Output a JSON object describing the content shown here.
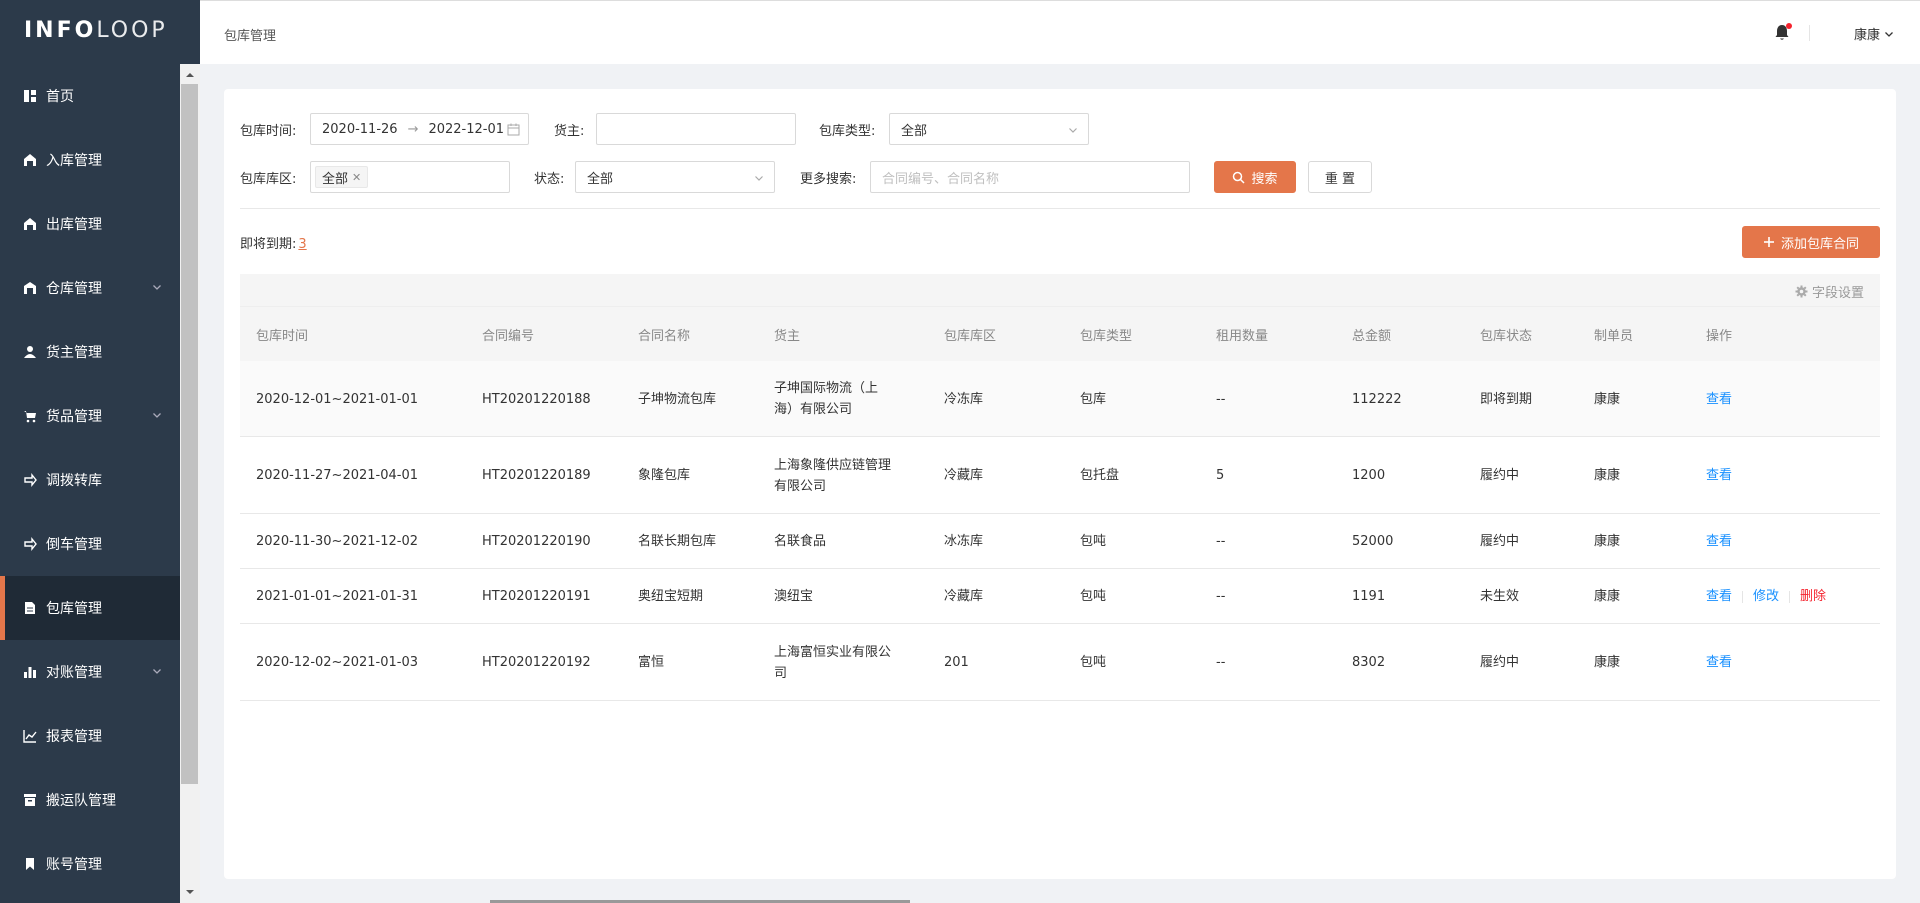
{
  "brand": {
    "bold": "INFO",
    "light": "LOOP"
  },
  "sidebar": {
    "items": [
      {
        "label": "首页",
        "icon": "dashboard-icon",
        "expandable": false,
        "active": false
      },
      {
        "label": "入库管理",
        "icon": "warehouse-in-icon",
        "expandable": false,
        "active": false
      },
      {
        "label": "出库管理",
        "icon": "warehouse-out-icon",
        "expandable": false,
        "active": false
      },
      {
        "label": "仓库管理",
        "icon": "warehouse-icon",
        "expandable": true,
        "active": false
      },
      {
        "label": "货主管理",
        "icon": "user-icon",
        "expandable": false,
        "active": false
      },
      {
        "label": "货品管理",
        "icon": "cart-icon",
        "expandable": true,
        "active": false
      },
      {
        "label": "调拨转库",
        "icon": "transfer-icon",
        "expandable": false,
        "active": false
      },
      {
        "label": "倒车管理",
        "icon": "truck-icon",
        "expandable": false,
        "active": false
      },
      {
        "label": "包库管理",
        "icon": "document-icon",
        "expandable": false,
        "active": true
      },
      {
        "label": "对账管理",
        "icon": "bar-chart-icon",
        "expandable": true,
        "active": false
      },
      {
        "label": "报表管理",
        "icon": "line-chart-icon",
        "expandable": false,
        "active": false
      },
      {
        "label": "搬运队管理",
        "icon": "archive-icon",
        "expandable": false,
        "active": false
      },
      {
        "label": "账号管理",
        "icon": "bookmark-icon",
        "expandable": false,
        "active": false
      }
    ]
  },
  "header": {
    "breadcrumb": "包库管理",
    "user": "康康"
  },
  "filters": {
    "date_label": "包库时间:",
    "date_start": "2020-11-26",
    "date_end": "2022-12-01",
    "owner_label": "货主:",
    "owner_value": "",
    "type_label": "包库类型:",
    "type_value": "全部",
    "zone_label": "包库库区:",
    "zone_tag": "全部",
    "status_label": "状态:",
    "status_value": "全部",
    "more_label": "更多搜索:",
    "more_placeholder": "合同编号、合同名称",
    "search_btn": "搜索",
    "reset_btn": "重 置"
  },
  "expiring": {
    "label": "即将到期:",
    "count": "3"
  },
  "add_btn": "添加包库合同",
  "field_settings": "字段设置",
  "table": {
    "columns": [
      "包库时间",
      "合同编号",
      "合同名称",
      "货主",
      "包库库区",
      "包库类型",
      "租用数量",
      "总金额",
      "包库状态",
      "制单员",
      "操作"
    ],
    "rows": [
      {
        "time": "2020-12-01~2021-01-01",
        "code": "HT20201220188",
        "name": "子坤物流包库",
        "owner1": "子坤国际物流（上",
        "owner2": "海）有限公司",
        "zone": "冷冻库",
        "type": "包库",
        "qty": "--",
        "amount": "112222",
        "status": "即将到期",
        "creator": "康康",
        "view": "查看",
        "edit": "",
        "del": ""
      },
      {
        "time": "2020-11-27~2021-04-01",
        "code": "HT20201220189",
        "name": "象隆包库",
        "owner1": "上海象隆供应链管理",
        "owner2": "有限公司",
        "zone": "冷藏库",
        "type": "包托盘",
        "qty": "5",
        "amount": "1200",
        "status": "履约中",
        "creator": "康康",
        "view": "查看",
        "edit": "",
        "del": ""
      },
      {
        "time": "2020-11-30~2021-12-02",
        "code": "HT20201220190",
        "name": "名联长期包库",
        "owner1": "名联食品",
        "owner2": "",
        "zone": "冰冻库",
        "type": "包吨",
        "qty": "--",
        "amount": "52000",
        "status": "履约中",
        "creator": "康康",
        "view": "查看",
        "edit": "",
        "del": ""
      },
      {
        "time": "2021-01-01~2021-01-31",
        "code": "HT20201220191",
        "name": "奥纽宝短期",
        "owner1": "澳纽宝",
        "owner2": "",
        "zone": "冷藏库",
        "type": "包吨",
        "qty": "--",
        "amount": "1191",
        "status": "未生效",
        "creator": "康康",
        "view": "查看",
        "edit": "修改",
        "del": "删除"
      },
      {
        "time": "2020-12-02~2021-01-03",
        "code": "HT20201220192",
        "name": "富恒",
        "owner1": "上海富恒实业有限公",
        "owner2": "司",
        "zone": "201",
        "type": "包吨",
        "qty": "--",
        "amount": "8302",
        "status": "履约中",
        "creator": "康康",
        "view": "查看",
        "edit": "",
        "del": ""
      }
    ]
  },
  "colors": {
    "accent": "#e4764a",
    "sidebar_bg": "#2c3a4a",
    "link": "#1890ff",
    "danger": "#f5222d"
  }
}
